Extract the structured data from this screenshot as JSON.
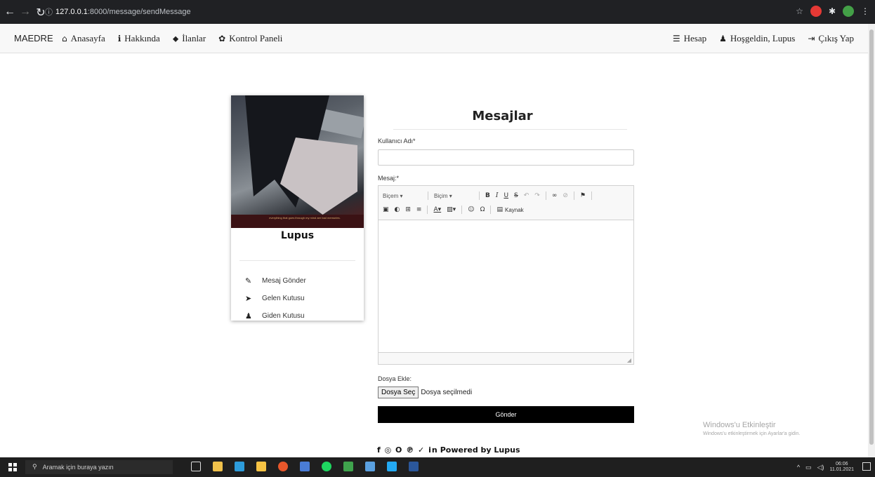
{
  "browser": {
    "url_host": "127.0.0.1",
    "url_path": ":8000/message/sendMessage"
  },
  "navbar": {
    "brand": "MAEDRE",
    "left": [
      {
        "icon": "home-icon",
        "glyph": "⌂",
        "label": "Anasayfa"
      },
      {
        "icon": "info-icon",
        "glyph": "ℹ",
        "label": "Hakkında"
      },
      {
        "icon": "tags-icon",
        "glyph": "⬥",
        "label": "İlanlar"
      },
      {
        "icon": "cog-icon",
        "glyph": "✿",
        "label": "Kontrol Paneli"
      }
    ],
    "right": [
      {
        "icon": "bars-icon",
        "glyph": "☰",
        "label": "Hesap"
      },
      {
        "icon": "user-icon",
        "glyph": "♟",
        "label": "Hoşgeldin, Lupus"
      },
      {
        "icon": "sign-out-icon",
        "glyph": "⇥",
        "label": "Çıkış Yap"
      }
    ]
  },
  "profile": {
    "name": "Lupus",
    "avatar_caption": "everything that goes through my mind are bad memories.",
    "menu": [
      {
        "icon": "pencil-icon",
        "glyph": "✎",
        "label": "Mesaj Gönder"
      },
      {
        "icon": "paper-plane-icon",
        "glyph": "➤",
        "label": "Gelen Kutusu"
      },
      {
        "icon": "users-icon",
        "glyph": "♟",
        "label": "Giden Kutusu"
      }
    ]
  },
  "form": {
    "title": "Mesajlar",
    "username_label": "Kullanıcı Adı*",
    "username_value": "",
    "message_label": "Mesaj:*",
    "editor": {
      "combo1": "Biçem",
      "combo2": "Biçim",
      "source_label": "Kaynak"
    },
    "file_label": "Dosya Ekle:",
    "file_button": "Dosya Seç",
    "file_status": "Dosya seçilmedi",
    "submit": "Gönder"
  },
  "footer": {
    "social": "f ◎ O ℗ ✓ in",
    "text": "Powered by Lupus"
  },
  "watermark": {
    "line1": "Windows'u Etkinleştir",
    "line2": "Windows'u etkinleştirmek için Ayarlar'a gidin."
  },
  "taskbar": {
    "search_placeholder": "Aramak için buraya yazın",
    "time": "06:06",
    "date": "11.01.2021"
  }
}
